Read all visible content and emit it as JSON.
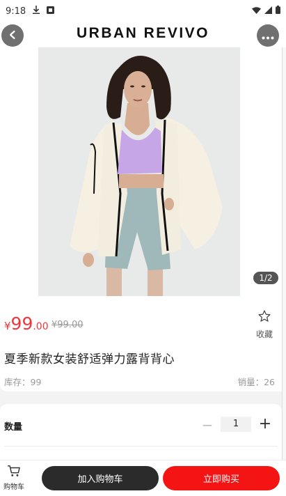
{
  "status_bar": {
    "time": "9:18",
    "icons_left": [
      "download-icon",
      "notification-icon"
    ],
    "icons_right": [
      "wifi-icon",
      "signal-icon",
      "battery-icon"
    ]
  },
  "header": {
    "brand": "URBAN REVIVO",
    "back_icon": "chevron-left-icon",
    "more_icon": "more-dots-icon"
  },
  "gallery": {
    "indicator": "1/2"
  },
  "product": {
    "currency": "¥",
    "price_int": "99",
    "price_dec": ".00",
    "original_price": "¥99.00",
    "favorite_label": "收藏",
    "title": "夏季新款女装舒适弹力露背背心",
    "stock": "库存：99",
    "sales": "销量：26",
    "accent_color": "#f2343b"
  },
  "quantity": {
    "label": "数量",
    "minus": "−",
    "value": "1",
    "plus": "+"
  },
  "bottom_bar": {
    "cart_label": "购物车",
    "add_to_cart": "加入购物车",
    "buy_now": "立即购买",
    "buy_color": "#f41414",
    "add_color": "#2b2b2b"
  }
}
